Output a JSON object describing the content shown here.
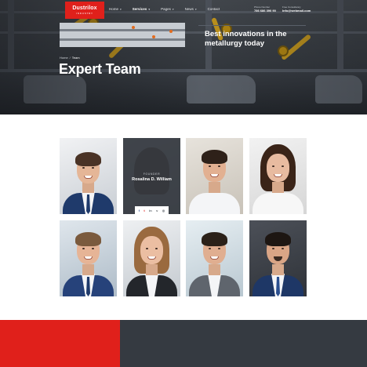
{
  "header": {
    "logo": {
      "name": "Dustrilox",
      "tagline": "INDUSTRY"
    },
    "nav": [
      {
        "label": "Home",
        "has_dropdown": true,
        "active": false
      },
      {
        "label": "Services",
        "has_dropdown": true,
        "active": true
      },
      {
        "label": "Pages",
        "has_dropdown": true,
        "active": false
      },
      {
        "label": "News",
        "has_dropdown": true,
        "active": false
      },
      {
        "label": "Contact",
        "has_dropdown": false,
        "active": false
      }
    ],
    "phone": {
      "label": "Phone Number",
      "value": "786 686 390 90"
    },
    "email": {
      "label": "Free Consultancy",
      "value": "Info@webmail.com"
    }
  },
  "hero": {
    "breadcrumb": {
      "home": "Home",
      "separator": "/",
      "current": "Team"
    },
    "title": "Expert Team"
  },
  "team": {
    "members": [
      {
        "id": "member-1"
      },
      {
        "id": "member-2",
        "role": "FOUNDER",
        "name": "Rosalina D. William",
        "hovered": true,
        "socials": [
          "facebook-icon",
          "twitter-icon",
          "linkedin-icon",
          "vimeo-icon",
          "instagram-icon"
        ]
      },
      {
        "id": "member-3"
      },
      {
        "id": "member-4"
      },
      {
        "id": "member-5"
      },
      {
        "id": "member-6"
      },
      {
        "id": "member-7"
      },
      {
        "id": "member-8"
      }
    ],
    "social_glyphs": {
      "facebook": "f",
      "twitter": "t",
      "linkedin": "in",
      "vimeo": "v",
      "instagram": "◎"
    }
  },
  "promo": {
    "title": "Best innovations in the metallurgy today"
  },
  "colors": {
    "brand_red": "#e0201b",
    "dark_panel": "#353a41",
    "hero_dark": "#2b2f34"
  }
}
